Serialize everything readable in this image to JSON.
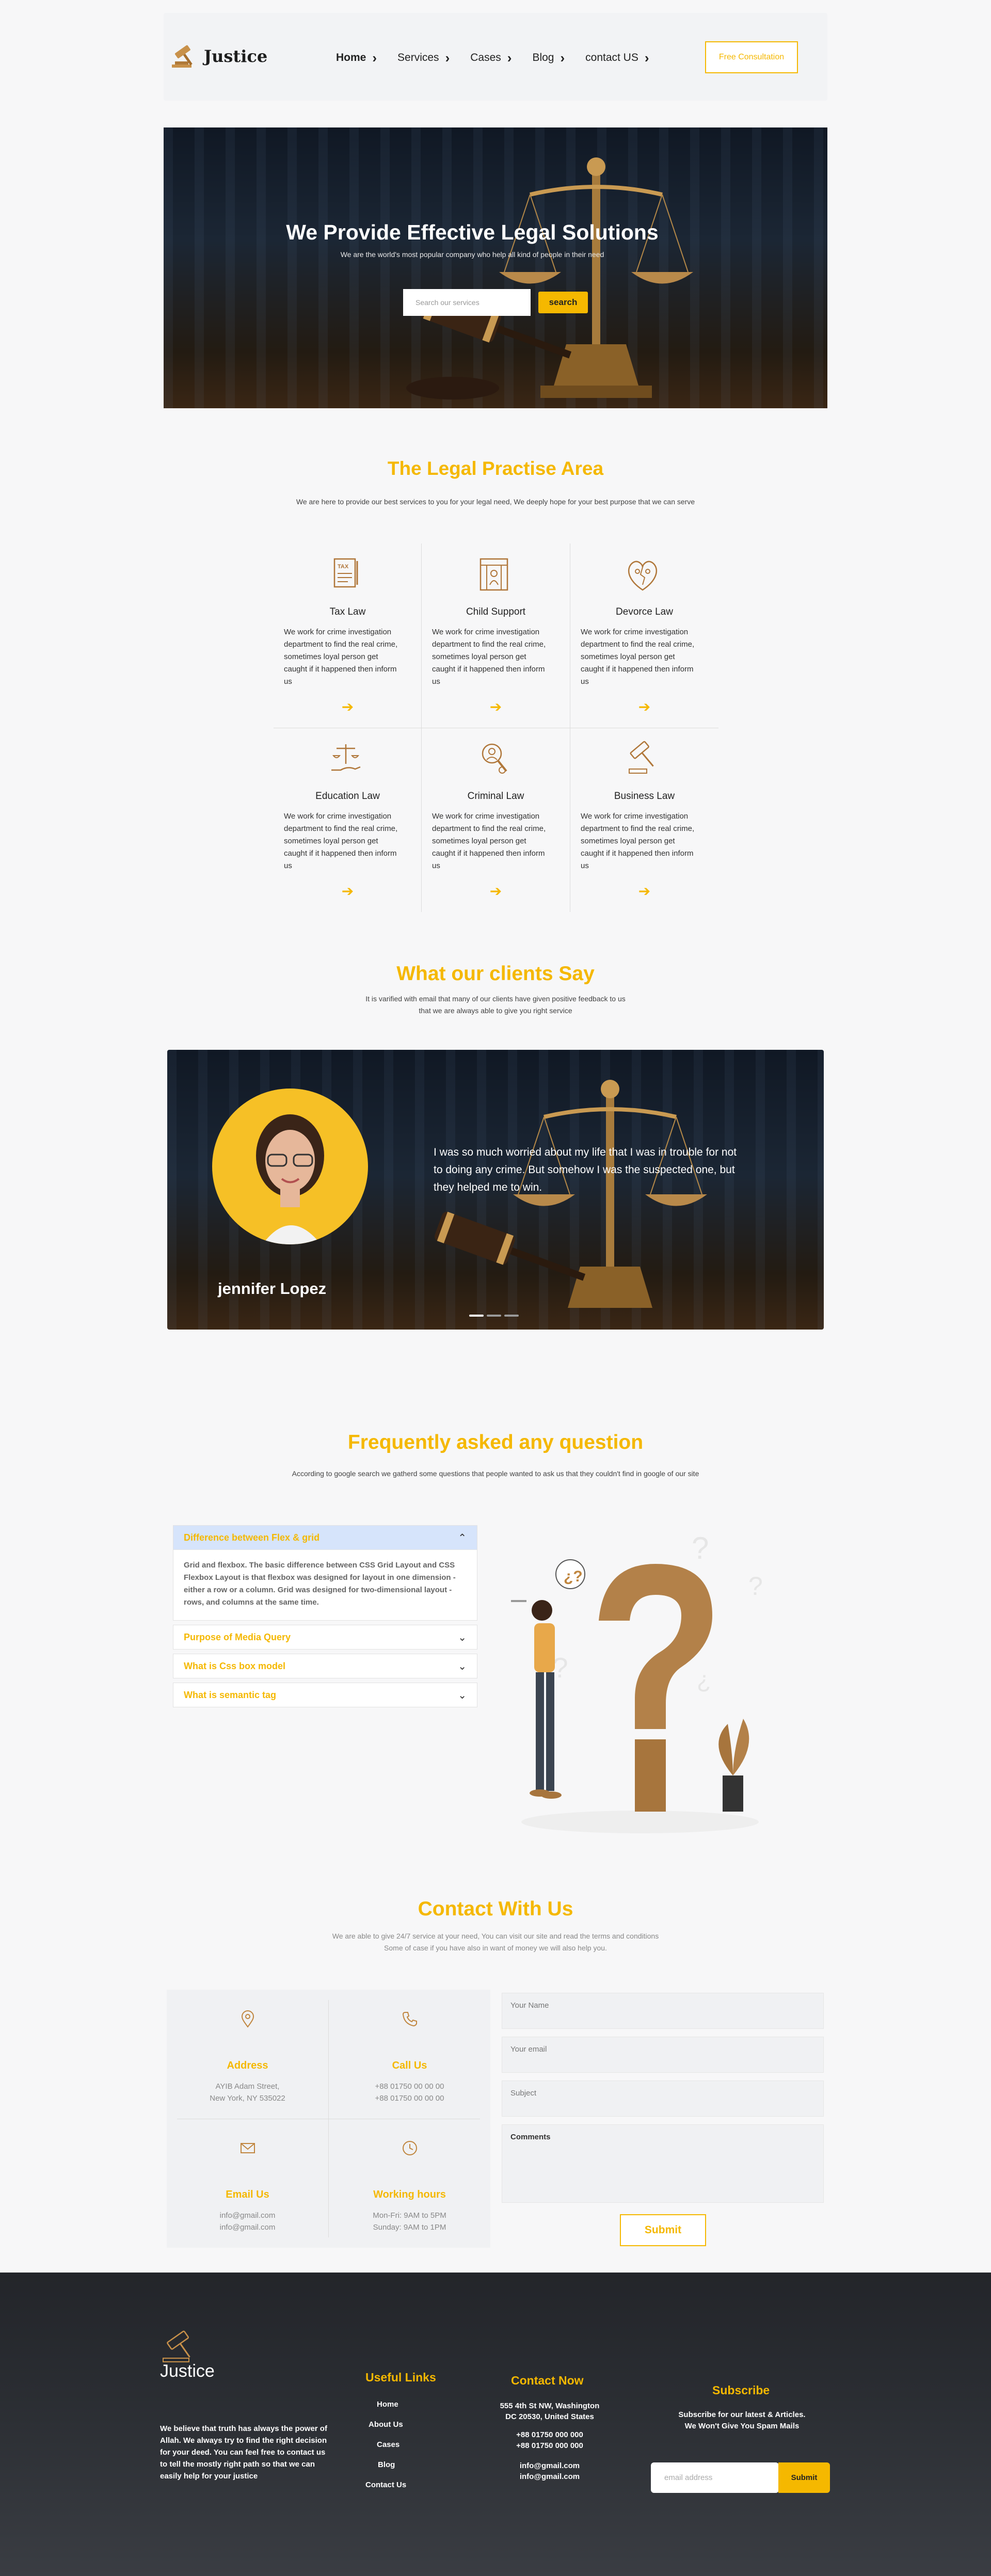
{
  "colors": {
    "accent": "#f5b800",
    "footer_bg": "#2a2d32",
    "faq_open_bg": "#d6e4fb"
  },
  "header": {
    "brand": "Justice",
    "nav": [
      {
        "label": "Home"
      },
      {
        "label": "Services"
      },
      {
        "label": "Cases"
      },
      {
        "label": "Blog"
      },
      {
        "label": "contact US"
      }
    ],
    "cta": "Free Consultation"
  },
  "hero": {
    "title": "We Provide Effective Legal Solutions",
    "subtitle": "We are the world's most popular company who help all kind of people in their need",
    "search_placeholder": "Search our services",
    "search_button": "search"
  },
  "practice": {
    "title": "The Legal Practise Area",
    "subtitle": "We are here to provide our best services to you for your legal need, We deeply hope for your best purpose that we can serve",
    "items": [
      {
        "name": "Tax Law",
        "icon": "tax-document-icon",
        "desc": "We work for crime investigation department to find the real crime, sometimes loyal person get caught if it happened then inform us"
      },
      {
        "name": "Child Support",
        "icon": "child-support-icon",
        "desc": "We work for crime investigation department to find the real crime, sometimes loyal person get caught if it happened then inform us"
      },
      {
        "name": "Devorce Law",
        "icon": "divorce-icon",
        "desc": "We work for crime investigation department to find the real crime, sometimes loyal person get caught if it happened then inform us"
      },
      {
        "name": "Education Law",
        "icon": "scales-hand-icon",
        "desc": "We work for crime investigation department to find the real crime, sometimes loyal person get caught if it happened then inform us"
      },
      {
        "name": "Criminal Law",
        "icon": "criminal-search-icon",
        "desc": "We work for crime investigation department to find the real crime, sometimes loyal person get caught if it happened then inform us"
      },
      {
        "name": "Business Law",
        "icon": "gavel-icon",
        "desc": "We work for crime investigation department to find the real crime, sometimes loyal person get caught if it happened then inform us"
      }
    ]
  },
  "clients": {
    "title": "What our clients Say",
    "subtitle_1": "It is varified with email that many of our clients have given positive feedback to us",
    "subtitle_2": "that we are always able to give you right service",
    "quote": "I was so much worried about my life that I was in trouble for not to doing any crime. But somehow I was the suspected one, but they helped me to win.",
    "name": "jennifer Lopez"
  },
  "faq": {
    "title": "Frequently asked any question",
    "subtitle": "According to google search we gatherd some questions that people wanted to ask us that they couldn't find in google of our site",
    "items": [
      {
        "q": "Difference between Flex & grid",
        "a": "Grid and flexbox. The basic difference between CSS Grid Layout and CSS Flexbox Layout is that flexbox was designed for layout in one dimension - either a row or a column. Grid was designed for two-dimensional layout - rows, and columns at the same time."
      },
      {
        "q": "Purpose of Media Query"
      },
      {
        "q": "What is Css box model"
      },
      {
        "q": "What is semantic tag"
      }
    ]
  },
  "contact": {
    "title": "Contact With Us",
    "subtitle_1": "We are able to give 24/7 service at your need, You can visit our site and read the terms and conditions",
    "subtitle_2": "Some of case if you have also in want of money we will also help you.",
    "boxes": [
      {
        "title": "Address",
        "icon": "location-pin-icon",
        "line1": "AYIB Adam Street,",
        "line2": "New York, NY 535022"
      },
      {
        "title": "Call Us",
        "icon": "phone-icon",
        "line1": "+88 01750 00 00 00",
        "line2": "+88 01750 00 00 00"
      },
      {
        "title": "Email Us",
        "icon": "envelope-icon",
        "line1": "info@gmail.com",
        "line2": "info@gmail.com"
      },
      {
        "title": "Working hours",
        "icon": "clock-icon",
        "line1": "Mon-Fri: 9AM to 5PM",
        "line2": "Sunday: 9AM to 1PM"
      }
    ],
    "form": {
      "name": "Your Name",
      "email": "Your email",
      "subject": "Subject",
      "comments": "Comments",
      "submit": "Submit"
    }
  },
  "footer": {
    "brand": "Justice",
    "desc": "We believe that truth has always the power of Allah. We always try to find the right decision for your deed. You can feel free to contact us to tell the mostly right path so that we can easily help for your justice",
    "links_title": "Useful Links",
    "links": [
      "Home",
      "About Us",
      "Cases",
      "Blog",
      "Contact Us"
    ],
    "contact_title": "Contact Now",
    "address_1": "555 4th St NW, Washington",
    "address_2": "DC 20530, United States",
    "phone_1": "+88 01750 000 000",
    "phone_2": "+88 01750 000 000",
    "email_1": "info@gmail.com",
    "email_2": "info@gmail.com",
    "subscribe_title": "Subscribe",
    "subscribe_text_1": "Subscribe for our latest & Articles.",
    "subscribe_text_2": "We Won't Give You Spam Mails",
    "email_placeholder": "email address",
    "submit": "Submit"
  }
}
